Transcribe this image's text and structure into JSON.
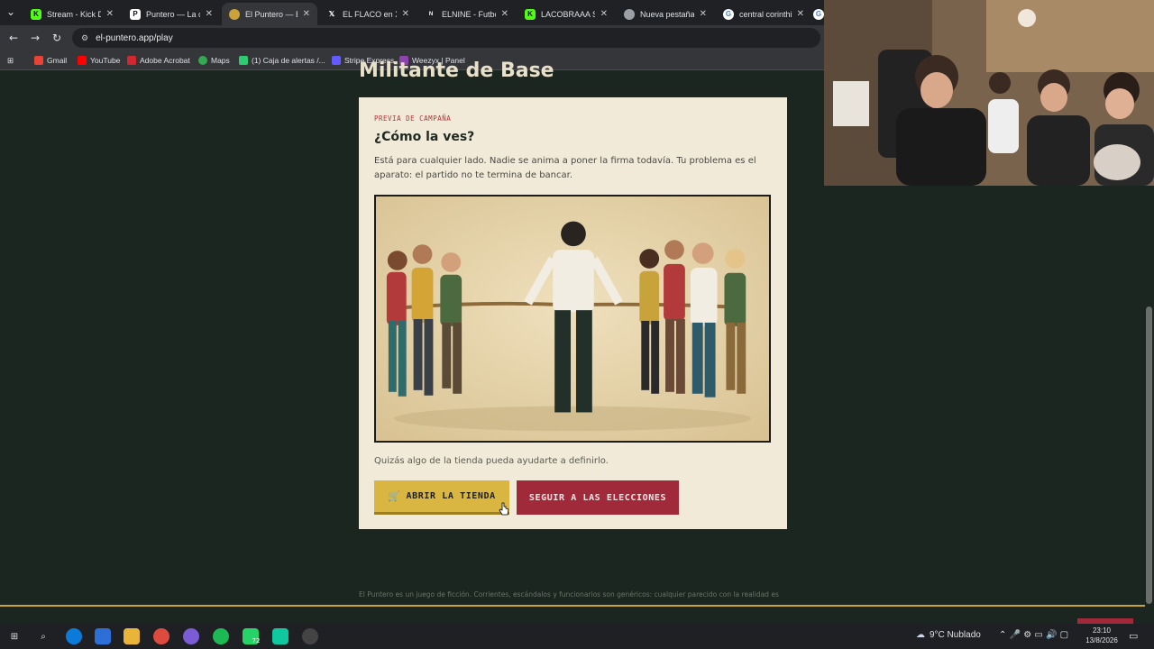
{
  "browser": {
    "tabs": [
      {
        "title": "Stream - Kick Da",
        "icon": "kick-icon",
        "color": "#53fc18"
      },
      {
        "title": "Puntero — La cal",
        "icon": "p-icon",
        "color": "#ffffff"
      },
      {
        "title": "El Puntero — En",
        "icon": "puntero-icon",
        "color": "#c9a23a",
        "active": true
      },
      {
        "title": "EL FLACO en X: \"",
        "icon": "x-icon",
        "color": "#ffffff"
      },
      {
        "title": "ELNINE - Futbol",
        "icon": "elnine-icon",
        "color": "#ffffff"
      },
      {
        "title": "LACOBRAAA Stre",
        "icon": "kick-icon",
        "color": "#53fc18"
      },
      {
        "title": "Nueva pestaña",
        "icon": "globe-icon",
        "color": "#c8c8c8"
      },
      {
        "title": "central corinthian",
        "icon": "google-icon",
        "color": "#4285f4"
      }
    ],
    "url": "el-puntero.app/play",
    "bookmarks": [
      {
        "label": "Gmail",
        "color": "#ea4335"
      },
      {
        "label": "YouTube",
        "color": "#ff0000"
      },
      {
        "label": "Adobe Acrobat",
        "color": "#d4272d"
      },
      {
        "label": "Maps",
        "color": "#34a853"
      },
      {
        "label": "(1) Caja de alertas /...",
        "color": "#2ecc71"
      },
      {
        "label": "Stripe Express",
        "color": "#635bff"
      },
      {
        "label": "Weezyx | Panel",
        "color": "#8e44ad"
      }
    ]
  },
  "page": {
    "heading": "Militante de Base",
    "eyebrow": "PREVIA DE CAMPAÑA",
    "title": "¿Cómo la ves?",
    "description": "Está para cualquier lado. Nadie se anima a poner la firma todavía. Tu problema es el aparato: el partido no te termina de bancar.",
    "hint": "Quizás algo de la tienda pueda ayudarte a definirlo.",
    "store_button": "ABRIR LA TIENDA",
    "store_icon": "cart-icon",
    "elections_button": "SEGUIR A LAS ELECCIONES",
    "footer": "El Puntero es un juego de ficción. Corrientes, escándalos y funcionarios son genéricos: cualquier parecido con la realidad es"
  },
  "taskbar": {
    "weather": "9°C  Nublado",
    "time": "23:10",
    "date": "13/8/2026",
    "whatsapp_badge": "72"
  },
  "colors": {
    "background": "#1b2620",
    "card": "#f1ead8",
    "accent_gold": "#d9b541",
    "accent_red": "#a02a3a"
  }
}
